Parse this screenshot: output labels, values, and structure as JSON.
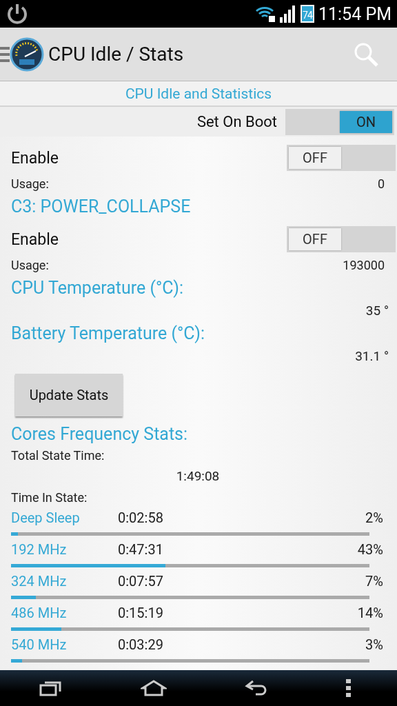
{
  "status_bar": {
    "battery": "74",
    "time": "11:54 PM"
  },
  "action_bar": {
    "title": "CPU Idle / Stats"
  },
  "subtitle": "CPU Idle and Statistics",
  "set_on_boot": {
    "label": "Set On Boot",
    "on": true,
    "switch_text": "ON"
  },
  "idle_states": [
    {
      "enable_label": "Enable",
      "on": false,
      "switch_text": "OFF",
      "usage_label": "Usage:",
      "usage": "0"
    },
    {
      "heading": "C3: POWER_COLLAPSE",
      "enable_label": "Enable",
      "on": false,
      "switch_text": "OFF",
      "usage_label": "Usage:",
      "usage": "193000"
    }
  ],
  "temperatures": [
    {
      "heading": "CPU Temperature (°C):",
      "value": "35 °"
    },
    {
      "heading": "Battery Temperature (°C):",
      "value": "31.1 °"
    }
  ],
  "update_button": "Update Stats",
  "cores": {
    "heading": "Cores Frequency Stats:",
    "total_label": "Total State Time:",
    "total": "1:49:08",
    "time_in_state_label": "Time In State:",
    "states": [
      {
        "name": "Deep Sleep",
        "time": "0:02:58",
        "percent": "2%",
        "level": 0.02
      },
      {
        "name": "192 MHz",
        "time": "0:47:31",
        "percent": "43%",
        "level": 0.43
      },
      {
        "name": "324 MHz",
        "time": "0:07:57",
        "percent": "7%",
        "level": 0.07
      },
      {
        "name": "486 MHz",
        "time": "0:15:19",
        "percent": "14%",
        "level": 0.14
      },
      {
        "name": "540 MHz",
        "time": "0:03:29",
        "percent": "3%",
        "level": 0.03
      }
    ]
  }
}
